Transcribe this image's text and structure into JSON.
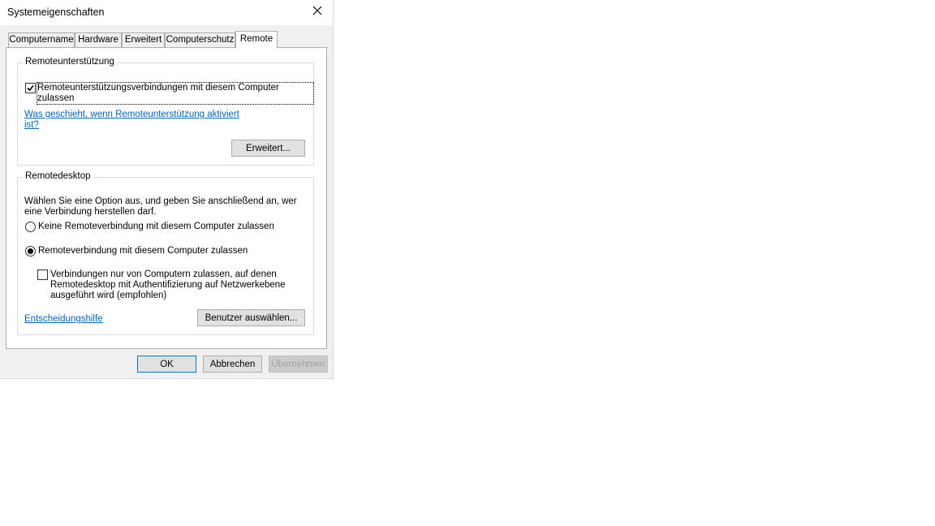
{
  "window": {
    "title": "Systemeigenschaften"
  },
  "tabs": [
    {
      "label": "Computername"
    },
    {
      "label": "Hardware"
    },
    {
      "label": "Erweitert"
    },
    {
      "label": "Computerschutz"
    },
    {
      "label": "Remote"
    }
  ],
  "remote_assistance": {
    "legend": "Remoteunterstützung",
    "checkbox_label": "Remoteunterstützungsverbindungen mit diesem Computer zulassen",
    "checked": true,
    "link_line1": "Was geschieht, wenn Remoteunterstützung aktiviert",
    "link_line2": "ist?",
    "advanced_button": "Erweitert..."
  },
  "remote_desktop": {
    "legend": "Remotedesktop",
    "description_line1": "Wählen Sie eine Option aus, und geben Sie anschließend an, wer",
    "description_line2": "eine Verbindung herstellen darf.",
    "option_none": "Keine Remoteverbindung mit diesem Computer zulassen",
    "option_allow": "Remoteverbindung mit diesem Computer zulassen",
    "nla_line1": "Verbindungen nur von Computern zulassen, auf denen",
    "nla_line2": "Remotedesktop mit Authentifizierung auf Netzwerkebene",
    "nla_line3": "ausgeführt wird (empfohlen)",
    "help_link": "Entscheidungshilfe",
    "select_users_button": "Benutzer auswählen..."
  },
  "footer": {
    "ok": "OK",
    "cancel": "Abbrechen",
    "apply": "Übernehmen"
  }
}
